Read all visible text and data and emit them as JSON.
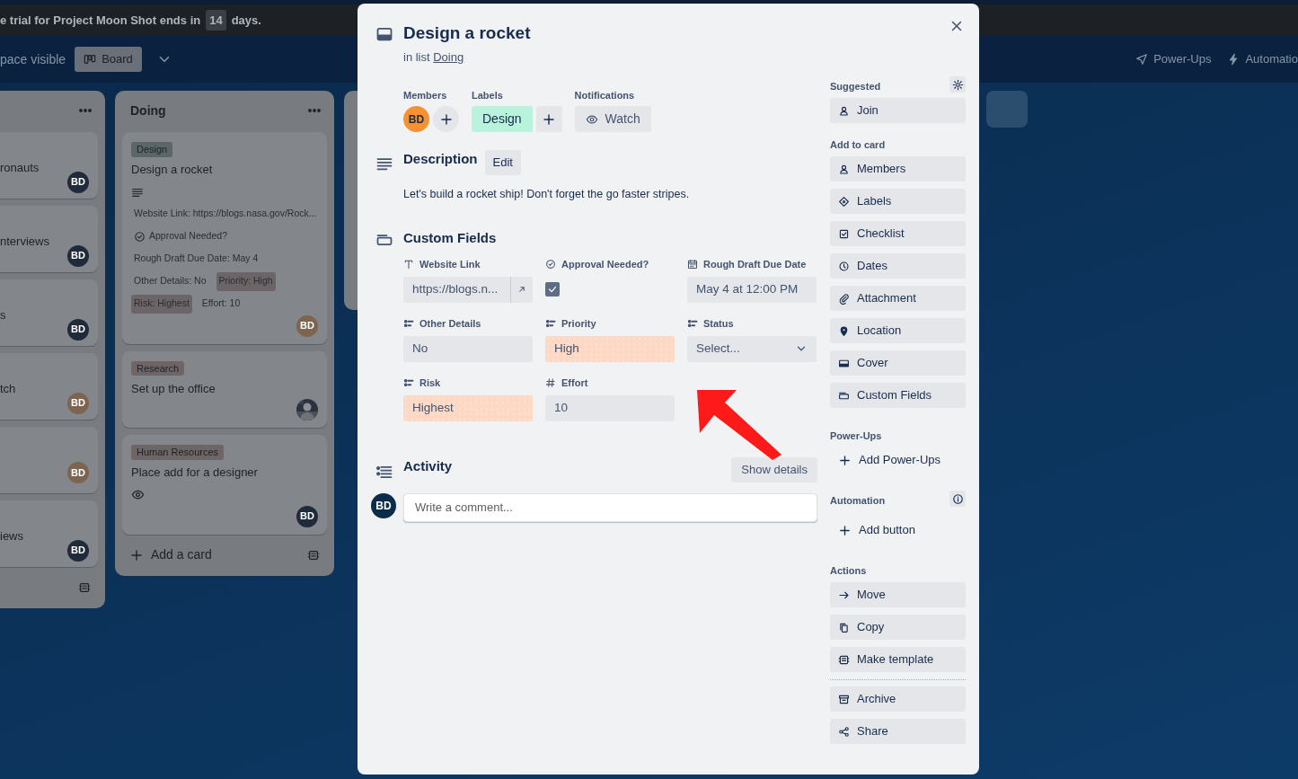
{
  "banner": {
    "text_before": "e trial for Project Moon Shot ends in",
    "count": "14",
    "text_after": "days."
  },
  "board_header": {
    "visibility": "pace visible",
    "view": "Board",
    "actions": [
      "Power-Ups",
      "Automatio"
    ]
  },
  "lists": [
    {
      "cards": [
        {
          "title": "ronauts",
          "member": {
            "kind": "initials",
            "initials": "BD",
            "color": "#1f2a3b"
          }
        },
        {
          "title": "nterviews",
          "member": {
            "kind": "initials",
            "initials": "BD",
            "color": "#1f2a3b"
          }
        },
        {
          "title": "s",
          "member": {
            "kind": "initials",
            "initials": "BD",
            "color": "#1f2a3b"
          }
        },
        {
          "title": "tch",
          "member": {
            "kind": "initials",
            "initials": "BD",
            "color": "#7d6450"
          }
        },
        {
          "member": {
            "kind": "initials",
            "initials": "BD",
            "color": "#7d6450"
          }
        },
        {
          "title": "iews",
          "member": {
            "kind": "initials",
            "initials": "BD",
            "color": "#1f2a3b"
          }
        }
      ]
    },
    {
      "title": "Doing",
      "add_card": "Add a card",
      "cards": [
        {
          "label": {
            "text": "Design",
            "color": "#5b6668"
          },
          "title": "Design a rocket",
          "has_description": true,
          "watching": false,
          "badges": [
            {
              "kind": "text",
              "text": "Website Link: https://blogs.nasa.gov/Rock...",
              "highlighted": false
            },
            {
              "kind": "check",
              "text": "Approval Needed?",
              "highlighted": false
            },
            {
              "kind": "text",
              "text": "Rough Draft Due Date: May 4",
              "highlighted": false
            },
            {
              "kind": "text",
              "text": "Other Details: No",
              "highlighted": false
            },
            {
              "kind": "text",
              "text": "Priority: High",
              "highlighted": true
            },
            {
              "kind": "text",
              "text": "Risk: Highest",
              "highlighted": true
            },
            {
              "kind": "text",
              "text": "Effort: 10",
              "highlighted": false
            }
          ],
          "member": {
            "kind": "initials",
            "initials": "BD",
            "color": "#7d6450"
          }
        },
        {
          "label": {
            "text": "Research",
            "color": "#6e6566"
          },
          "title": "Set up the office",
          "has_description": false,
          "watching": false
        },
        {
          "label": {
            "text": "Human Resources",
            "color": "#6e6566"
          },
          "title": "Place add for a designer",
          "has_description": false,
          "watching": true,
          "member": {
            "kind": "initials",
            "initials": "BD",
            "color": "#1f2a3b"
          }
        }
      ]
    }
  ],
  "card": {
    "title": "Design a rocket",
    "list_prefix": "in list",
    "list_name": "Doing",
    "members": {
      "heading": "Members",
      "people": [
        {
          "initials": "BD",
          "color": "#f79233"
        }
      ]
    },
    "labels": {
      "heading": "Labels",
      "items": [
        {
          "text": "Design",
          "color": "#baf3db"
        }
      ]
    },
    "notifications": {
      "heading": "Notifications",
      "button": "Watch"
    },
    "description": {
      "heading": "Description",
      "edit": "Edit",
      "text": "Let's build a rocket ship! Don't forget the go faster stripes."
    },
    "custom_fields": {
      "heading": "Custom Fields",
      "fields": [
        {
          "kind": "text",
          "name": "Website Link",
          "value": "https://blogs.n...",
          "color": "#e4e6ea"
        },
        {
          "kind": "checkbox",
          "name": "Approval Needed?",
          "checked": true
        },
        {
          "kind": "date",
          "name": "Rough Draft Due Date",
          "value": "May 4 at 12:00 PM",
          "color": "#e4e6ea"
        },
        {
          "kind": "dropdown",
          "name": "Other Details",
          "value": "No",
          "color": "#e4e6ea"
        },
        {
          "kind": "dropdown",
          "name": "Priority",
          "value": "High",
          "color": "#fdd8c5"
        },
        {
          "kind": "dropdown",
          "name": "Status",
          "placeholder": "Select...",
          "color": "#e4e6ea"
        },
        {
          "kind": "dropdown",
          "name": "Risk",
          "value": "Highest",
          "color": "#fdd8c5"
        },
        {
          "kind": "number",
          "name": "Effort",
          "value": "10",
          "color": "#e4e6ea"
        }
      ]
    },
    "activity": {
      "heading": "Activity",
      "toggle": "Show details",
      "commenter": {
        "initials": "BD",
        "color": "#0c2d4a"
      },
      "placeholder": "Write a comment..."
    },
    "sidebar": [
      {
        "heading": "Suggested",
        "items": [
          {
            "text": "Join",
            "divider_before": false
          }
        ]
      },
      {
        "heading": "Add to card",
        "items": [
          {
            "text": "Members",
            "divider_before": false
          },
          {
            "text": "Labels",
            "divider_before": false
          },
          {
            "text": "Checklist",
            "divider_before": false
          },
          {
            "text": "Dates",
            "divider_before": false
          },
          {
            "text": "Attachment",
            "divider_before": false
          },
          {
            "text": "Location",
            "divider_before": false
          },
          {
            "text": "Cover",
            "divider_before": false
          },
          {
            "text": "Custom Fields",
            "divider_before": false
          }
        ]
      },
      {
        "heading": "Power-Ups",
        "items": [
          {
            "text": "Add Power-Ups",
            "divider_before": false
          }
        ]
      },
      {
        "heading": "Automation",
        "items": [
          {
            "text": "Add button",
            "divider_before": false
          }
        ]
      },
      {
        "heading": "Actions",
        "items": [
          {
            "text": "Move",
            "divider_before": false
          },
          {
            "text": "Copy",
            "divider_before": false
          },
          {
            "text": "Make template",
            "divider_before": false
          },
          {
            "text": "Archive",
            "divider_before": true
          },
          {
            "text": "Share",
            "divider_before": false
          }
        ]
      }
    ]
  }
}
